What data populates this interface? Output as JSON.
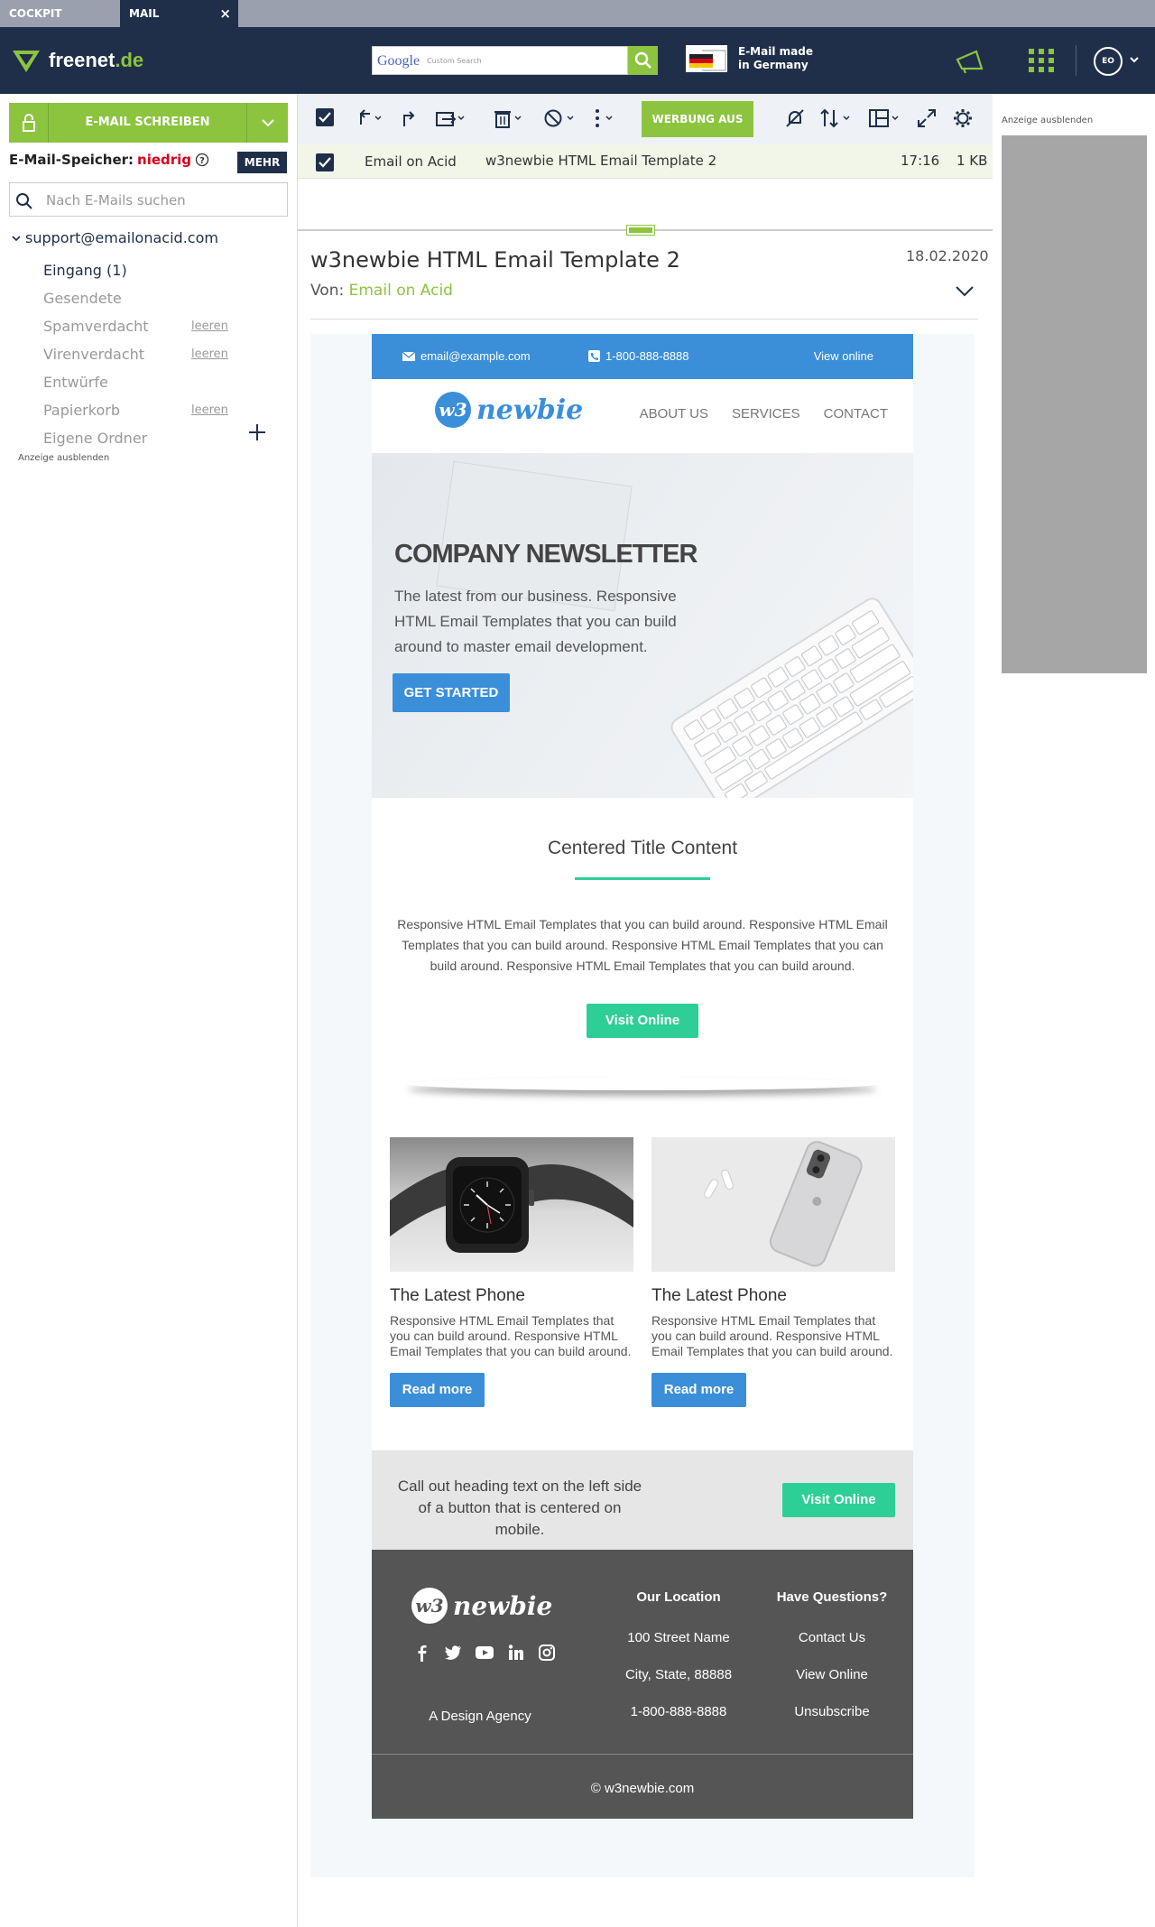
{
  "tabs": {
    "cockpit": "COCKPIT",
    "mail": "MAIL",
    "close": "×"
  },
  "header": {
    "brand": "freenet",
    "brand_suffix": ".de",
    "search_brand": "Google",
    "search_placeholder": "Custom Search",
    "germany_line1": "E-Mail made",
    "germany_line2": "in Germany",
    "avatar_initials": "EO"
  },
  "sidebar": {
    "compose_label": "E-MAIL SCHREIBEN",
    "storage_label": "E-Mail-Speicher:",
    "storage_value": "niedrig",
    "more_button": "MEHR",
    "search_placeholder": "Nach E-Mails suchen",
    "account": "support@emailonacid.com",
    "folders": [
      {
        "label": "Eingang (1)",
        "action": ""
      },
      {
        "label": "Gesendete",
        "action": ""
      },
      {
        "label": "Spamverdacht",
        "action": "leeren"
      },
      {
        "label": "Virenverdacht",
        "action": "leeren"
      },
      {
        "label": "Entwürfe",
        "action": ""
      },
      {
        "label": "Papierkorb",
        "action": "leeren"
      },
      {
        "label": "Eigene Ordner",
        "action": ""
      }
    ],
    "hide_ad": "Anzeige ausblenden"
  },
  "toolbar": {
    "ads_toggle": "WERBUNG AUS"
  },
  "message_list": [
    {
      "from": "Email on Acid",
      "subject": "w3newbie HTML Email Template 2",
      "time": "17:16",
      "size": "1 KB"
    }
  ],
  "reader": {
    "title": "w3newbie HTML Email Template 2",
    "date": "18.02.2020",
    "from_label": "Von:",
    "from_name": "Email on Acid"
  },
  "email": {
    "top_email": "email@example.com",
    "top_phone": "1-800-888-8888",
    "top_view_online": "View online",
    "logo_text": "newbie",
    "nav": [
      "ABOUT US",
      "SERVICES",
      "CONTACT"
    ],
    "hero_title": "COMPANY NEWSLETTER",
    "hero_text": "The latest from our business. Responsive HTML Email Templates that you can build around to master email development.",
    "hero_button": "GET STARTED",
    "center_title": "Centered Title Content",
    "center_text": "Responsive HTML Email Templates that you can build around. Responsive HTML Email Templates that you can build around. Responsive HTML Email Templates that you can build around. Responsive HTML Email Templates that you can build around.",
    "center_button": "Visit Online",
    "cards": [
      {
        "title": "The Latest Phone",
        "text": "Responsive HTML Email Templates that you can build around. Responsive HTML Email Templates that you can build around.",
        "button": "Read more"
      },
      {
        "title": "The Latest Phone",
        "text": "Responsive HTML Email Templates that you can build around. Responsive HTML Email Templates that you can build around.",
        "button": "Read more"
      }
    ],
    "callout_text": "Call out heading text on the left side of a button that is centered on mobile.",
    "callout_button": "Visit Online",
    "footer": {
      "logo_text": "newbie",
      "agency": "A Design Agency",
      "location_heading": "Our Location",
      "location": [
        "100 Street Name",
        "City, State, 88888",
        "1-800-888-8888"
      ],
      "questions_heading": "Have Questions?",
      "questions": [
        "Contact Us",
        "View Online",
        "Unsubscribe"
      ],
      "copyright": "© w3newbie.com"
    }
  },
  "right": {
    "hide_ad": "Anzeige ausblenden"
  },
  "colors": {
    "navy": "#1f2f4a",
    "green": "#8cc43f",
    "blue": "#3b8fd9",
    "teal": "#2ecf96",
    "red": "#d6001c"
  }
}
